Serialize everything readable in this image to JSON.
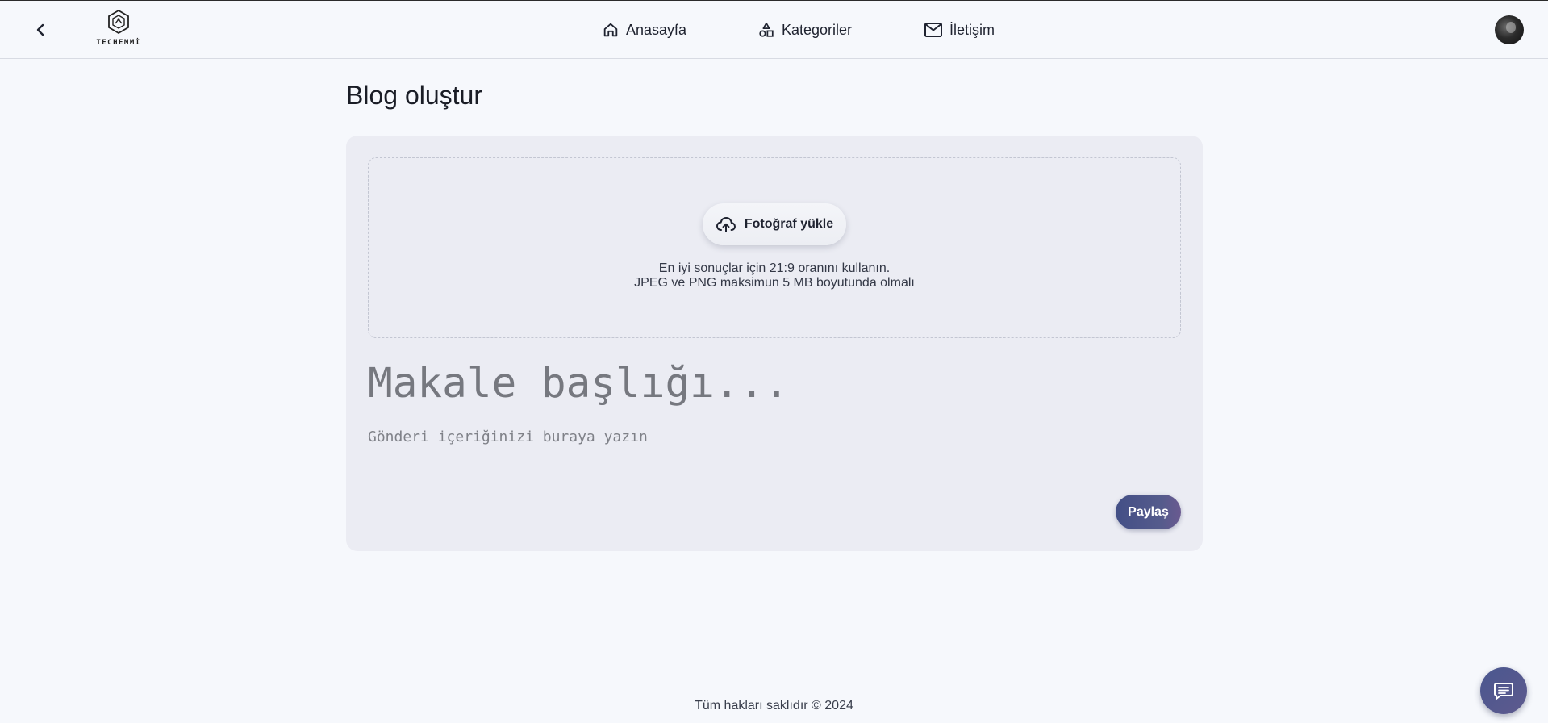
{
  "header": {
    "logo_text": "TECHEMMİ",
    "nav": [
      {
        "label": "Anasayfa",
        "icon": "home-icon"
      },
      {
        "label": "Kategoriler",
        "icon": "shapes-icon"
      },
      {
        "label": "İletişim",
        "icon": "mail-icon"
      }
    ]
  },
  "page": {
    "title": "Blog oluştur"
  },
  "editor": {
    "upload_label": "Fotoğraf yükle",
    "hint_line1": "En iyi sonuçlar için 21:9 oranını kullanın.",
    "hint_line2": "JPEG ve PNG maksimun 5 MB boyutunda olmalı",
    "title_placeholder": "Makale başlığı...",
    "content_placeholder": "Gönderi içeriğinizi buraya yazın",
    "share_label": "Paylaş"
  },
  "footer": {
    "text": "Tüm hakları saklıdır © 2024"
  },
  "colors": {
    "background": "#f6f8fc",
    "card": "#ebecf3",
    "accent": "#434f86"
  }
}
